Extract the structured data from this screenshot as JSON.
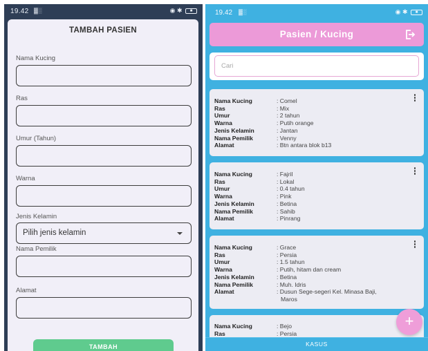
{
  "left": {
    "status": {
      "time": "19.42",
      "signal": "▓░"
    },
    "dialog": {
      "title": "TAMBAH PASIEN",
      "fields": {
        "nama_kucing": {
          "label": "Nama Kucing",
          "value": ""
        },
        "ras": {
          "label": "Ras",
          "value": ""
        },
        "umur": {
          "label": "Umur (Tahun)",
          "value": ""
        },
        "warna": {
          "label": "Warna",
          "value": ""
        },
        "jenis_kelamin": {
          "label": "Jenis Kelamin",
          "selected": "Pilih jenis kelamin"
        },
        "nama_pemilik": {
          "label": "Nama Pemilik",
          "value": ""
        },
        "alamat": {
          "label": "Alamat",
          "value": ""
        }
      },
      "submit_label": "TAMBAH"
    }
  },
  "right": {
    "status": {
      "time": "19.42",
      "signal": "▓░"
    },
    "header": {
      "title": "Pasien / Kucing"
    },
    "search": {
      "placeholder": "Cari"
    },
    "labels": {
      "nama_kucing": "Nama Kucing",
      "ras": "Ras",
      "umur": "Umur",
      "warna": "Warna",
      "jenis_kelamin": "Jenis Kelamin",
      "nama_pemilik": "Nama Pemilik",
      "alamat": "Alamat"
    },
    "patients": [
      {
        "nama_kucing": ": Comel",
        "ras": ": Mix",
        "umur": ": 2 tahun",
        "warna": ": Putih orange",
        "jenis_kelamin": ": Jantan",
        "nama_pemilik": ": Venny",
        "alamat": ": Btn antara blok b13"
      },
      {
        "nama_kucing": ": Fajril",
        "ras": ": Lokal",
        "umur": ": 0.4 tahun",
        "warna": ": Pink",
        "jenis_kelamin": ": Betina",
        "nama_pemilik": ": Sahib",
        "alamat": ": Pinrang"
      },
      {
        "nama_kucing": ": Grace",
        "ras": ": Persia",
        "umur": ": 1.5 tahun",
        "warna": ": Putih, hitam dan cream",
        "jenis_kelamin": ": Betina",
        "nama_pemilik": ": Muh. Idris",
        "alamat": ": Dusun Sege-segeri Kel. Minasa Baji,",
        "alamat_2": "Maros"
      },
      {
        "nama_kucing": ": Bejo",
        "ras": ": Persia"
      }
    ],
    "fab_label": "+",
    "bottom_nav": {
      "label": "KASUS"
    },
    "colors": {
      "accent_pink": "#ec9ad8",
      "background_blue": "#3fb1e1",
      "button_green": "#5fcb8e"
    }
  }
}
